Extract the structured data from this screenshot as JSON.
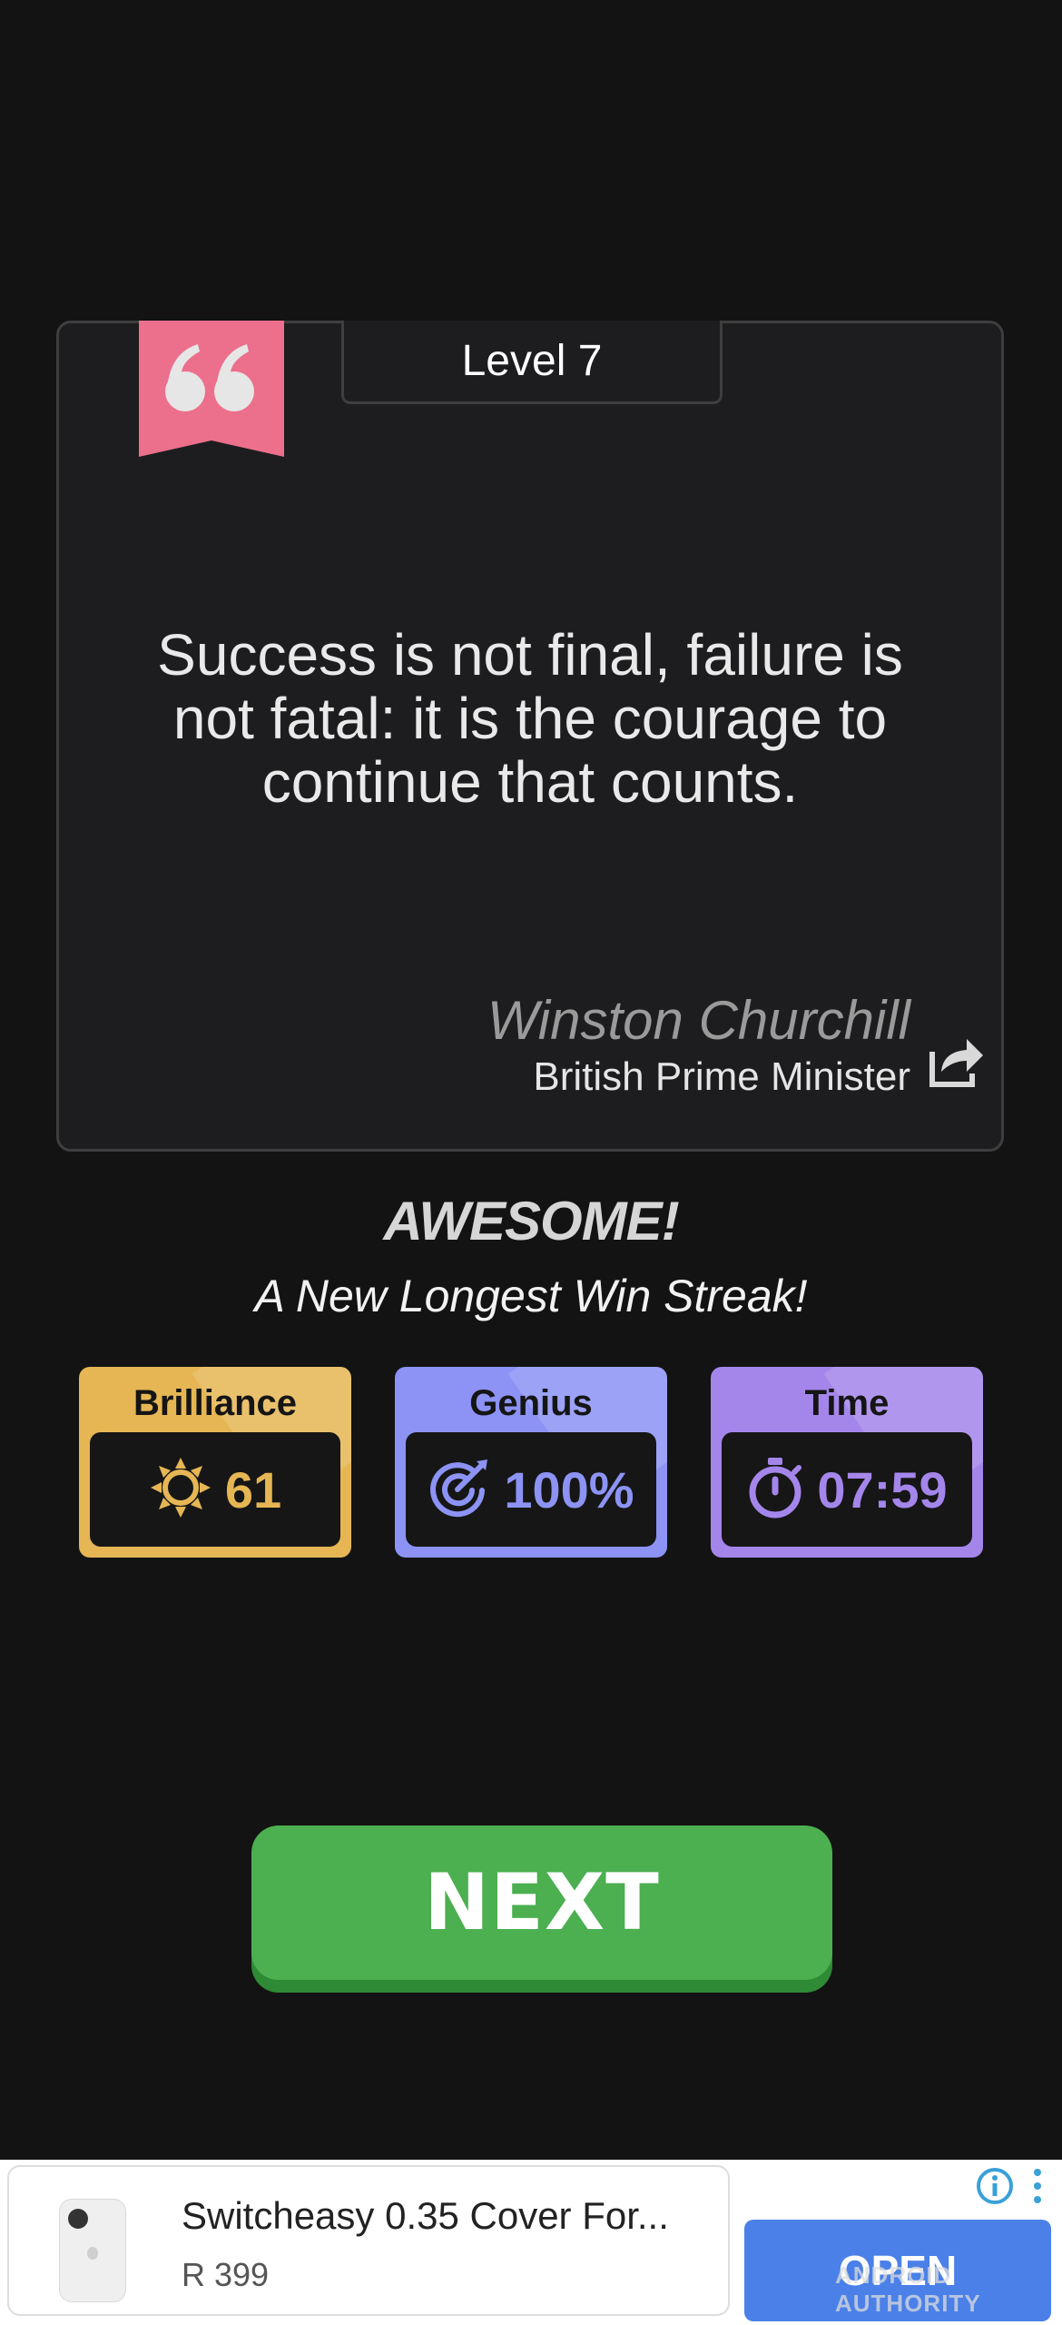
{
  "card": {
    "level": "Level 7",
    "quote": "Success is not final, failure is not fatal: it is the courage to continue that counts.",
    "author": "Winston Churchill",
    "author_title": "British Prime Minister",
    "icons": {
      "bookmark": "quote-bookmark-icon",
      "share": "share-icon"
    }
  },
  "result": {
    "headline": "AWESOME!",
    "subtitle": "A New Longest Win Streak!"
  },
  "stats": [
    {
      "label": "Brilliance",
      "value": "61",
      "icon": "sun-icon",
      "color": "#e6b654"
    },
    {
      "label": "Genius",
      "value": "100%",
      "icon": "target-icon",
      "color": "#8c93f4"
    },
    {
      "label": "Time",
      "value": "07:59",
      "icon": "stopwatch-icon",
      "color": "#a486eb"
    }
  ],
  "next_button": "NEXT",
  "ad": {
    "title": "Switcheasy 0.35 Cover For...",
    "price": "R 399",
    "cta": "OPEN"
  },
  "watermark": "ANDROID AUTHORITY",
  "colors": {
    "background": "#131313",
    "next": "#4caf50",
    "bookmark": "#ec6f8c"
  }
}
